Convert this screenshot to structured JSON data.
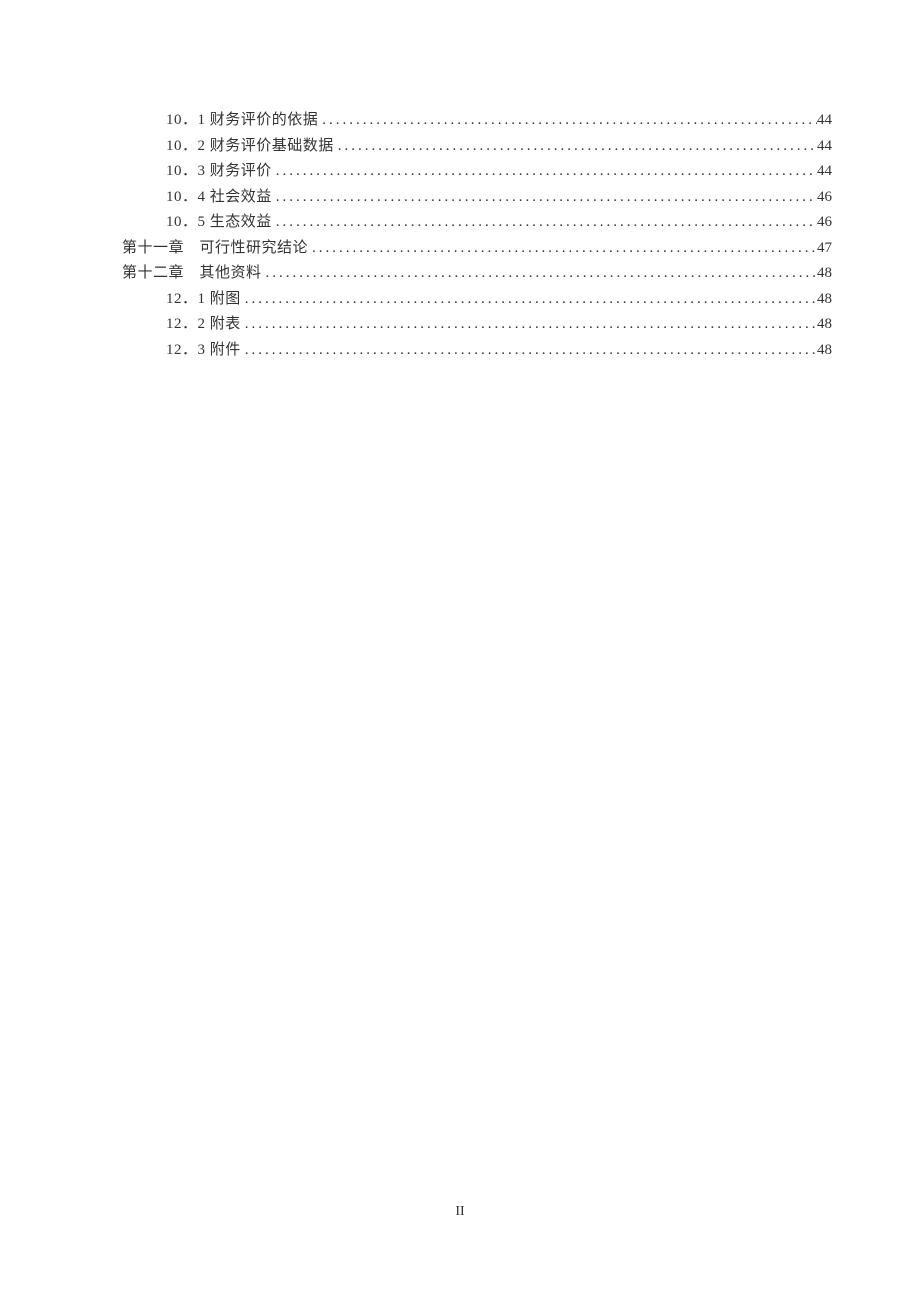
{
  "toc": [
    {
      "level": 2,
      "title": "10．1 财务评价的依据",
      "page": "44"
    },
    {
      "level": 2,
      "title": "10．2 财务评价基础数据",
      "page": "44"
    },
    {
      "level": 2,
      "title": "10．3 财务评价",
      "page": "44"
    },
    {
      "level": 2,
      "title": "10．4 社会效益",
      "page": "46"
    },
    {
      "level": 2,
      "title": "10．5 生态效益",
      "page": "46"
    },
    {
      "level": 1,
      "title": "第十一章　可行性研究结论",
      "page": "47"
    },
    {
      "level": 1,
      "title": "第十二章　其他资料",
      "page": "48"
    },
    {
      "level": 2,
      "title": "12．1 附图",
      "page": "48"
    },
    {
      "level": 2,
      "title": "12．2 附表",
      "page": "48"
    },
    {
      "level": 2,
      "title": "12．3 附件",
      "page": "48"
    }
  ],
  "pageNumber": "II"
}
